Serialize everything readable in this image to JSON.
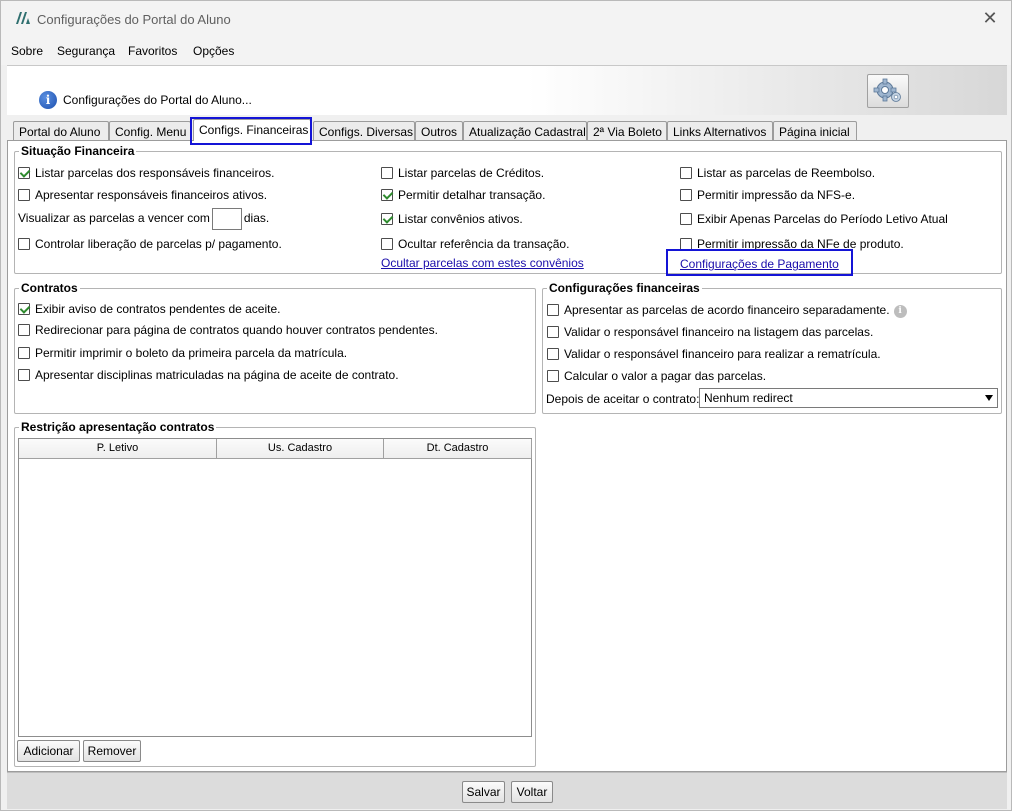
{
  "window": {
    "title": "Configurações do Portal do Aluno",
    "close_glyph": "✕",
    "icon": "app-logo-icon"
  },
  "menu": [
    "Sobre",
    "Segurança",
    "Favoritos",
    "Opções"
  ],
  "header": {
    "text": "Configurações do Portal do Aluno...",
    "info_glyph": "i",
    "settings_icon": "gear-settings-icon"
  },
  "tabs": [
    "Portal do Aluno",
    "Config. Menu",
    "Configs. Financeiras",
    "Configs. Diversas",
    "Outros",
    "Atualização Cadastral",
    "2ª Via Boleto",
    "Links Alternativos",
    "Página inicial"
  ],
  "active_tab": "Configs. Financeiras",
  "highlight_color": "#1414d6",
  "situacao": {
    "legend": "Situação Financeira",
    "col1": [
      {
        "label": "Listar parcelas dos responsáveis financeiros.",
        "checked": true
      },
      {
        "label": "Apresentar responsáveis financeiros ativos.",
        "checked": false
      },
      {
        "label": "Controlar liberação de parcelas p/ pagamento.",
        "checked": false
      }
    ],
    "vencer_prefix": "Visualizar as parcelas a vencer com",
    "vencer_value": "",
    "vencer_suffix": "dias.",
    "col2": [
      {
        "label": "Listar parcelas de Créditos.",
        "checked": false
      },
      {
        "label": "Permitir detalhar transação.",
        "checked": true
      },
      {
        "label": "Listar convênios ativos.",
        "checked": true
      },
      {
        "label": "Ocultar referência da transação.",
        "checked": false
      }
    ],
    "link_convenios": "Ocultar parcelas com estes convênios",
    "col3": [
      {
        "label": "Listar as parcelas de Reembolso.",
        "checked": false
      },
      {
        "label": "Permitir impressão da NFS-e.",
        "checked": false
      },
      {
        "label": "Exibir Apenas Parcelas do Período Letivo Atual",
        "checked": false
      },
      {
        "label": "Permitir impressão da NFe de produto.",
        "checked": false
      }
    ],
    "link_pagamento": "Configurações de Pagamento"
  },
  "contratos": {
    "legend": "Contratos",
    "items": [
      {
        "label": "Exibir aviso de contratos pendentes de aceite.",
        "checked": true
      },
      {
        "label": "Redirecionar para página de contratos quando houver contratos pendentes.",
        "checked": false
      },
      {
        "label": "Permitir imprimir o boleto da primeira parcela da matrícula.",
        "checked": false
      },
      {
        "label": "Apresentar disciplinas matriculadas na página de aceite de contrato.",
        "checked": false
      }
    ]
  },
  "config_fin": {
    "legend": "Configurações financeiras",
    "items": [
      {
        "label": "Apresentar as parcelas de acordo financeiro separadamente.",
        "checked": false
      },
      {
        "label": "Validar o responsável financeiro na listagem das parcelas.",
        "checked": false
      },
      {
        "label": "Validar o responsável financeiro para realizar a rematrícula.",
        "checked": false
      },
      {
        "label": "Calcular o valor a pagar das parcelas.",
        "checked": false
      }
    ],
    "after_accept_label": "Depois de aceitar o contrato:",
    "after_accept_value": "Nenhum redirect"
  },
  "restricao": {
    "legend": "Restrição apresentação contratos",
    "columns": [
      "P. Letivo",
      "Us. Cadastro",
      "Dt. Cadastro"
    ],
    "rows": [],
    "add_label": "Adicionar",
    "remove_label": "Remover"
  },
  "footer": {
    "save_label": "Salvar",
    "back_label": "Voltar"
  }
}
